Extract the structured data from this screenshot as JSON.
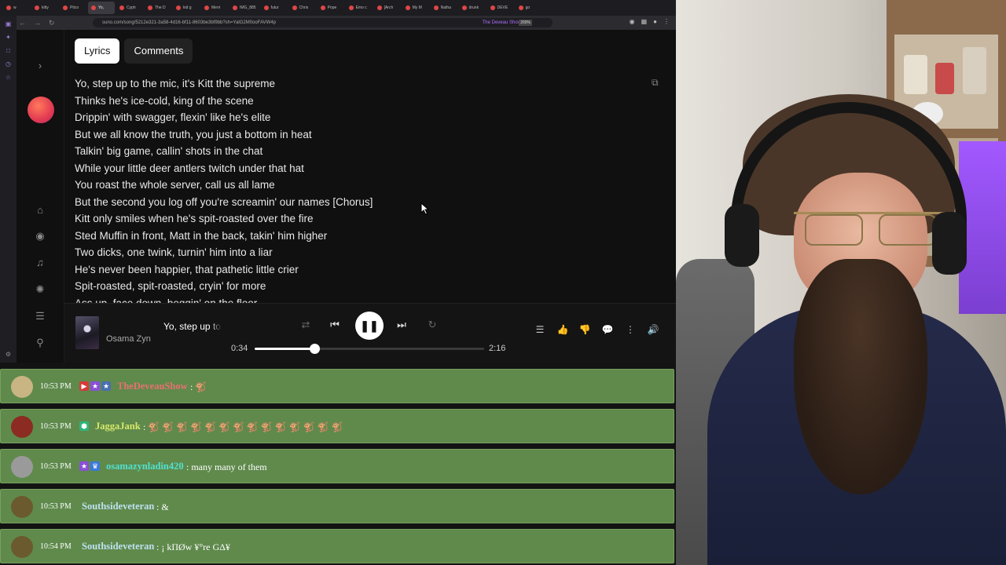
{
  "browser": {
    "tabs": [
      {
        "label": "w"
      },
      {
        "label": "kitty"
      },
      {
        "label": "Pitco"
      },
      {
        "label": "Yo,"
      },
      {
        "label": "Cyph"
      },
      {
        "label": "The D"
      },
      {
        "label": "kid g"
      },
      {
        "label": "Merri"
      },
      {
        "label": "IMG_885"
      },
      {
        "label": "futur"
      },
      {
        "label": "Chris"
      },
      {
        "label": "Pope"
      },
      {
        "label": "Emo c"
      },
      {
        "label": "[Arch"
      },
      {
        "label": "My M"
      },
      {
        "label": "Natha"
      },
      {
        "label": "drunk"
      },
      {
        "label": "DEVE"
      },
      {
        "label": "go"
      }
    ],
    "url": "suno.com/song/5212e321-3a58-4d16-bf11-8603be3bf9bb?sh=YalG2M0ooFAVW4p",
    "extension_label": "The Deveau Show",
    "zoom": "200%"
  },
  "tabs": {
    "lyrics": "Lyrics",
    "comments": "Comments"
  },
  "lyrics": [
    "Yo, step up to the mic, it's Kitt the supreme",
    "Thinks he's ice-cold, king of the scene",
    "Drippin' with swagger, flexin' like he's elite",
    "But we all know the truth, you just a bottom in heat",
    "Talkin' big game, callin' shots in the chat",
    "While your little deer antlers twitch under that hat",
    "You roast the whole server, call us all lame",
    "But the second you log off you're screamin' our names  [Chorus]",
    "Kitt only smiles when he's spit-roasted over the fire",
    "Sted Muffin in front, Matt in the back, takin' him higher",
    "Two dicks, one twink, turnin' him into a liar",
    "He's never been happier, that pathetic little crier",
    "Spit-roasted, spit-roasted, cryin' for more",
    "Ass up, face down, beggin' on the floor"
  ],
  "player": {
    "title": "Yo, step up to",
    "artist": "Osama Zyn",
    "current_time": "0:34",
    "total_time": "2:16",
    "progress": 0.26
  },
  "chat": [
    {
      "time": "10:53 PM",
      "user": "TheDeveauShow",
      "user_color": "#e87070",
      "message": ": 🐒",
      "badges": [
        "#d43a3a",
        "#8a4fd6",
        "#4a6fb0"
      ],
      "badge_glyphs": [
        "▶",
        "★",
        "★"
      ],
      "avatar": "#c9b483"
    },
    {
      "time": "10:53 PM",
      "user": "JaggaJank",
      "user_color": "#d8e86a",
      "message": ": 🐒 🐒 🐒 🐒 🐒 🐒 🐒 🐒 🐒 🐒 🐒 🐒 🐒 🐒",
      "badges": [
        "#2fb57a"
      ],
      "badge_glyphs": [
        "⬢"
      ],
      "avatar": "#8b2b22"
    },
    {
      "time": "10:53 PM",
      "user": "osamazynladin420",
      "user_color": "#52e0d0",
      "message": ": many many of them",
      "badges": [
        "#8a4fd6",
        "#3b7ad8"
      ],
      "badge_glyphs": [
        "★",
        "♛"
      ],
      "avatar": "#9a9a9a"
    },
    {
      "time": "10:53 PM",
      "user": "Southsideveteran",
      "user_color": "#bfe0f0",
      "message": ": &",
      "badges": [],
      "badge_glyphs": [],
      "avatar": "#6b5a2e"
    },
    {
      "time": "10:54 PM",
      "user": "Southsideveteran",
      "user_color": "#bfe0f0",
      "message": ": ¡ kΠØw ¥°re GΔ¥",
      "badges": [],
      "badge_glyphs": [],
      "avatar": "#6b5a2e"
    }
  ]
}
